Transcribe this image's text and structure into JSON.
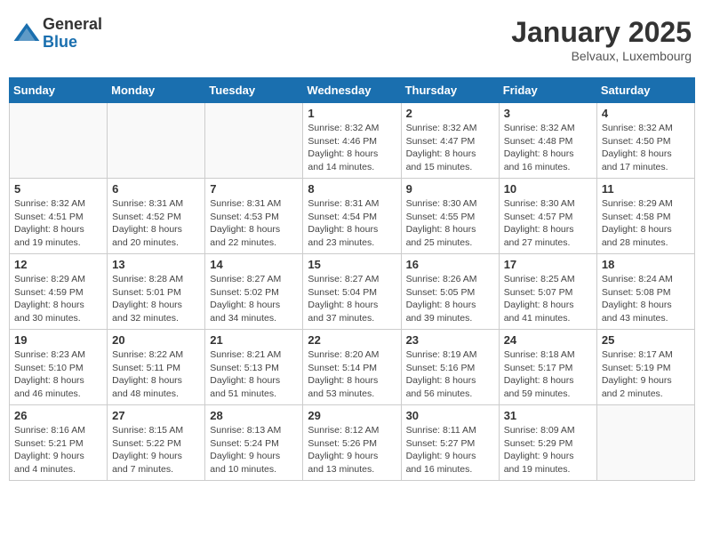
{
  "header": {
    "logo_general": "General",
    "logo_blue": "Blue",
    "month_title": "January 2025",
    "location": "Belvaux, Luxembourg"
  },
  "weekdays": [
    "Sunday",
    "Monday",
    "Tuesday",
    "Wednesday",
    "Thursday",
    "Friday",
    "Saturday"
  ],
  "weeks": [
    [
      {
        "day": "",
        "info": ""
      },
      {
        "day": "",
        "info": ""
      },
      {
        "day": "",
        "info": ""
      },
      {
        "day": "1",
        "info": "Sunrise: 8:32 AM\nSunset: 4:46 PM\nDaylight: 8 hours\nand 14 minutes."
      },
      {
        "day": "2",
        "info": "Sunrise: 8:32 AM\nSunset: 4:47 PM\nDaylight: 8 hours\nand 15 minutes."
      },
      {
        "day": "3",
        "info": "Sunrise: 8:32 AM\nSunset: 4:48 PM\nDaylight: 8 hours\nand 16 minutes."
      },
      {
        "day": "4",
        "info": "Sunrise: 8:32 AM\nSunset: 4:50 PM\nDaylight: 8 hours\nand 17 minutes."
      }
    ],
    [
      {
        "day": "5",
        "info": "Sunrise: 8:32 AM\nSunset: 4:51 PM\nDaylight: 8 hours\nand 19 minutes."
      },
      {
        "day": "6",
        "info": "Sunrise: 8:31 AM\nSunset: 4:52 PM\nDaylight: 8 hours\nand 20 minutes."
      },
      {
        "day": "7",
        "info": "Sunrise: 8:31 AM\nSunset: 4:53 PM\nDaylight: 8 hours\nand 22 minutes."
      },
      {
        "day": "8",
        "info": "Sunrise: 8:31 AM\nSunset: 4:54 PM\nDaylight: 8 hours\nand 23 minutes."
      },
      {
        "day": "9",
        "info": "Sunrise: 8:30 AM\nSunset: 4:55 PM\nDaylight: 8 hours\nand 25 minutes."
      },
      {
        "day": "10",
        "info": "Sunrise: 8:30 AM\nSunset: 4:57 PM\nDaylight: 8 hours\nand 27 minutes."
      },
      {
        "day": "11",
        "info": "Sunrise: 8:29 AM\nSunset: 4:58 PM\nDaylight: 8 hours\nand 28 minutes."
      }
    ],
    [
      {
        "day": "12",
        "info": "Sunrise: 8:29 AM\nSunset: 4:59 PM\nDaylight: 8 hours\nand 30 minutes."
      },
      {
        "day": "13",
        "info": "Sunrise: 8:28 AM\nSunset: 5:01 PM\nDaylight: 8 hours\nand 32 minutes."
      },
      {
        "day": "14",
        "info": "Sunrise: 8:27 AM\nSunset: 5:02 PM\nDaylight: 8 hours\nand 34 minutes."
      },
      {
        "day": "15",
        "info": "Sunrise: 8:27 AM\nSunset: 5:04 PM\nDaylight: 8 hours\nand 37 minutes."
      },
      {
        "day": "16",
        "info": "Sunrise: 8:26 AM\nSunset: 5:05 PM\nDaylight: 8 hours\nand 39 minutes."
      },
      {
        "day": "17",
        "info": "Sunrise: 8:25 AM\nSunset: 5:07 PM\nDaylight: 8 hours\nand 41 minutes."
      },
      {
        "day": "18",
        "info": "Sunrise: 8:24 AM\nSunset: 5:08 PM\nDaylight: 8 hours\nand 43 minutes."
      }
    ],
    [
      {
        "day": "19",
        "info": "Sunrise: 8:23 AM\nSunset: 5:10 PM\nDaylight: 8 hours\nand 46 minutes."
      },
      {
        "day": "20",
        "info": "Sunrise: 8:22 AM\nSunset: 5:11 PM\nDaylight: 8 hours\nand 48 minutes."
      },
      {
        "day": "21",
        "info": "Sunrise: 8:21 AM\nSunset: 5:13 PM\nDaylight: 8 hours\nand 51 minutes."
      },
      {
        "day": "22",
        "info": "Sunrise: 8:20 AM\nSunset: 5:14 PM\nDaylight: 8 hours\nand 53 minutes."
      },
      {
        "day": "23",
        "info": "Sunrise: 8:19 AM\nSunset: 5:16 PM\nDaylight: 8 hours\nand 56 minutes."
      },
      {
        "day": "24",
        "info": "Sunrise: 8:18 AM\nSunset: 5:17 PM\nDaylight: 8 hours\nand 59 minutes."
      },
      {
        "day": "25",
        "info": "Sunrise: 8:17 AM\nSunset: 5:19 PM\nDaylight: 9 hours\nand 2 minutes."
      }
    ],
    [
      {
        "day": "26",
        "info": "Sunrise: 8:16 AM\nSunset: 5:21 PM\nDaylight: 9 hours\nand 4 minutes."
      },
      {
        "day": "27",
        "info": "Sunrise: 8:15 AM\nSunset: 5:22 PM\nDaylight: 9 hours\nand 7 minutes."
      },
      {
        "day": "28",
        "info": "Sunrise: 8:13 AM\nSunset: 5:24 PM\nDaylight: 9 hours\nand 10 minutes."
      },
      {
        "day": "29",
        "info": "Sunrise: 8:12 AM\nSunset: 5:26 PM\nDaylight: 9 hours\nand 13 minutes."
      },
      {
        "day": "30",
        "info": "Sunrise: 8:11 AM\nSunset: 5:27 PM\nDaylight: 9 hours\nand 16 minutes."
      },
      {
        "day": "31",
        "info": "Sunrise: 8:09 AM\nSunset: 5:29 PM\nDaylight: 9 hours\nand 19 minutes."
      },
      {
        "day": "",
        "info": ""
      }
    ]
  ]
}
